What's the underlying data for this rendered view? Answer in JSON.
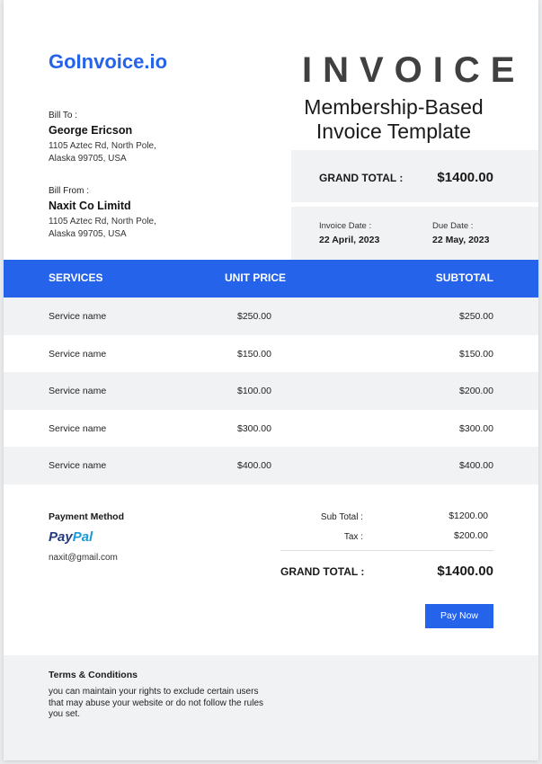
{
  "brand": "GoInvoice.io",
  "title": "INVOICE",
  "subtitle": "Membership-Based Invoice Template",
  "bill_to": {
    "label": "Bill To :",
    "name": "George Ericson",
    "address_line1": "1105 Aztec Rd, North Pole,",
    "address_line2": "Alaska 99705, USA"
  },
  "bill_from": {
    "label": "Bill From :",
    "name": "Naxit Co Limitd",
    "address_line1": "1105 Aztec Rd, North Pole,",
    "address_line2": "Alaska 99705, USA"
  },
  "grand_total": {
    "label": "GRAND TOTAL :",
    "value": "$1400.00"
  },
  "invoice_date": {
    "label": "Invoice Date :",
    "value": "22 April, 2023"
  },
  "due_date": {
    "label": "Due Date :",
    "value": "22 May, 2023"
  },
  "table": {
    "headers": [
      "SERVICES",
      "UNIT PRICE",
      "SUBTOTAL"
    ],
    "rows": [
      [
        "Service name",
        "$250.00",
        "$250.00"
      ],
      [
        "Service name",
        "$150.00",
        "$150.00"
      ],
      [
        "Service name",
        "$100.00",
        "$200.00"
      ],
      [
        "Service name",
        "$300.00",
        "$300.00"
      ],
      [
        "Service name",
        "$400.00",
        "$400.00"
      ]
    ]
  },
  "payment": {
    "title": "Payment Method",
    "provider_part1": "Pay",
    "provider_part2": "Pal",
    "email": "naxit@gmail.com"
  },
  "summary": {
    "subtotal_label": "Sub Total :",
    "subtotal_value": "$1200.00",
    "tax_label": "Tax :",
    "tax_value": "$200.00",
    "grand_label": "GRAND TOTAL :",
    "grand_value": "$1400.00"
  },
  "pay_button": "Pay Now",
  "terms": {
    "title": "Terms & Conditions",
    "body": "you can maintain your rights to exclude certain users that may abuse your website or do not follow the rules you set."
  },
  "colors": {
    "accent": "#2563eb",
    "panel": "#f1f2f4",
    "title": "#404040"
  }
}
